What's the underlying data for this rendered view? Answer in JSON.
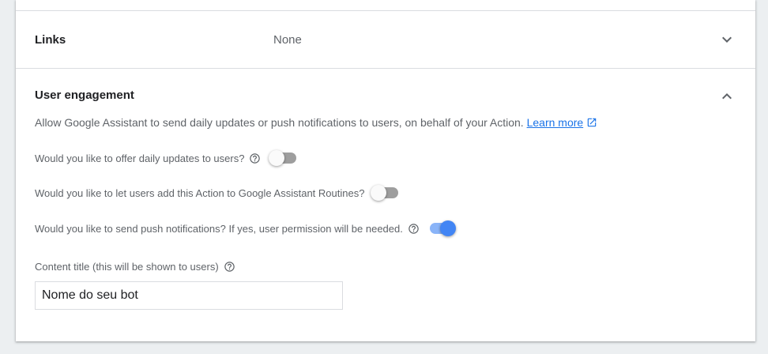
{
  "links": {
    "title": "Links",
    "value": "None"
  },
  "user_engagement": {
    "title": "User engagement",
    "description": "Allow Google Assistant to send daily updates or push notifications to users, on behalf of your Action.",
    "learn_more": "Learn more",
    "questions": [
      {
        "label": "Would you like to offer daily updates to users?",
        "has_help": true,
        "enabled": false
      },
      {
        "label": "Would you like to let users add this Action to Google Assistant Routines?",
        "has_help": false,
        "enabled": false
      },
      {
        "label": "Would you like to send push notifications? If yes, user permission will be needed.",
        "has_help": true,
        "enabled": true
      }
    ],
    "content_title": {
      "label": "Content title (this will be shown to users)",
      "value": "Nome do seu bot"
    }
  },
  "icons": {
    "links_chevron": "chevron-down-icon",
    "engagement_chevron": "chevron-up-icon",
    "help": "help-circle-icon",
    "external": "open-in-new-icon"
  },
  "colors": {
    "accent": "#4285f4",
    "link": "#1a73e8",
    "toggle_off": "#9e9e9e"
  }
}
